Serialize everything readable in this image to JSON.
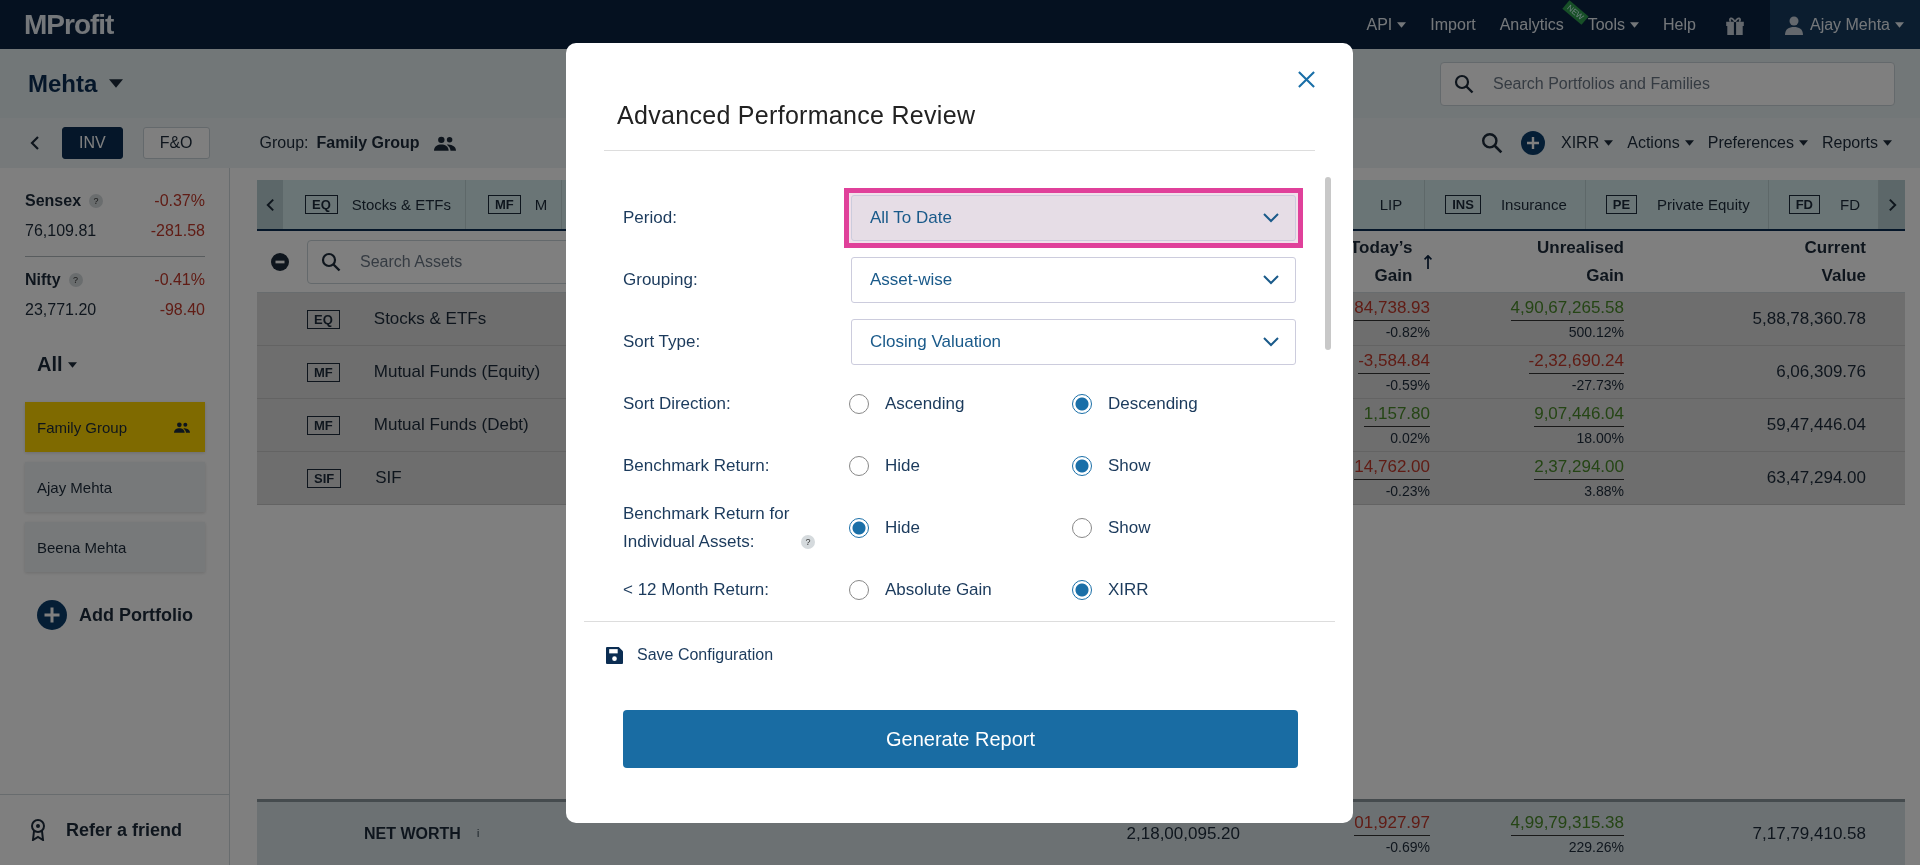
{
  "top_nav": {
    "logo": "MProfit",
    "items": [
      {
        "label": "API",
        "dropdown": true
      },
      {
        "label": "Import",
        "dropdown": false
      },
      {
        "label": "Analytics",
        "dropdown": false,
        "badge": "NEW"
      },
      {
        "label": "Tools",
        "dropdown": true
      },
      {
        "label": "Help",
        "dropdown": false
      }
    ],
    "user": "Ajay Mehta"
  },
  "header": {
    "family": "Mehta",
    "search_placeholder": "Search Portfolios and Families"
  },
  "toolbar": {
    "modes": [
      {
        "label": "INV",
        "selected": true
      },
      {
        "label": "F&O",
        "selected": false
      }
    ],
    "group_label": "Group:",
    "group_name": "Family Group",
    "menus": [
      "XIRR",
      "Actions",
      "Preferences",
      "Reports"
    ]
  },
  "indices": [
    {
      "name": "Sensex",
      "help": "?",
      "change_pct": "-0.37%",
      "value": "76,109.81",
      "change": "-281.58"
    },
    {
      "name": "Nifty",
      "help": "?",
      "change_pct": "-0.41%",
      "value": "23,771.20",
      "change": "-98.40"
    }
  ],
  "filter": "All",
  "portfolios": [
    {
      "label": "Family Group",
      "kind": "group",
      "selected": true
    },
    {
      "label": "Ajay Mehta",
      "kind": "portfolio",
      "selected": false
    },
    {
      "label": "Beena Mehta",
      "kind": "portfolio",
      "selected": false
    }
  ],
  "add_portfolio": "Add Portfolio",
  "refer": "Refer a friend",
  "asset_tabs": [
    {
      "code": "EQ",
      "label": "Stocks & ETFs"
    },
    {
      "code": "MF",
      "label": "M"
    },
    {
      "label": "LIP"
    },
    {
      "code": "INS",
      "label": "Insurance"
    },
    {
      "code": "PE",
      "label": "Private Equity"
    },
    {
      "code": "FD",
      "label": "FD"
    }
  ],
  "asset_search_placeholder": "Search Assets",
  "table": {
    "columns": [
      {
        "label": "Today’s Gain",
        "sorted": true
      },
      {
        "label": "Unrealised Gain",
        "sorted": false
      },
      {
        "label": "Current Value",
        "sorted": false
      }
    ],
    "rows": [
      {
        "code": "EQ",
        "name": "Stocks & ETFs",
        "todays_gain": "84,738.93",
        "todays_loss": true,
        "todays_pct": "-0.82%",
        "unrealised": "4,90,67,265.58",
        "unrealised_loss": false,
        "unrealised_pct": "500.12%",
        "current_value": "5,88,78,360.78"
      },
      {
        "code": "MF",
        "name": "Mutual Funds (Equity)",
        "todays_gain": "-3,584.84",
        "todays_loss": true,
        "todays_pct": "-0.59%",
        "unrealised": "-2,32,690.24",
        "unrealised_loss": true,
        "unrealised_pct": "-27.73%",
        "current_value": "6,06,309.76"
      },
      {
        "code": "MF",
        "name": "Mutual Funds (Debt)",
        "todays_gain": "1,157.80",
        "todays_loss": false,
        "todays_pct": "0.02%",
        "unrealised": "9,07,446.04",
        "unrealised_loss": false,
        "unrealised_pct": "18.00%",
        "current_value": "59,47,446.04"
      },
      {
        "code": "SIF",
        "name": "SIF",
        "todays_gain": "14,762.00",
        "todays_loss": true,
        "todays_pct": "-0.23%",
        "unrealised": "2,37,294.00",
        "unrealised_loss": false,
        "unrealised_pct": "3.88%",
        "current_value": "63,47,294.00"
      }
    ]
  },
  "net_worth": {
    "label": "NET WORTH",
    "info": "i",
    "invested": "2,18,00,095.20",
    "todays_gain": "01,927.97",
    "todays_loss": true,
    "todays_pct": "-0.69%",
    "unrealised": "4,99,79,315.38",
    "unrealised_loss": false,
    "unrealised_pct": "229.26%",
    "current_value": "7,17,79,410.58"
  },
  "modal": {
    "title": "Advanced Performance Review",
    "fields": [
      {
        "kind": "select",
        "label": "Period:",
        "value": "All To Date",
        "highlighted": true
      },
      {
        "kind": "select",
        "label": "Grouping:",
        "value": "Asset-wise",
        "highlighted": false
      },
      {
        "kind": "select",
        "label": "Sort Type:",
        "value": "Closing Valuation",
        "highlighted": false
      },
      {
        "kind": "radio",
        "label": "Sort Direction:",
        "options": [
          {
            "label": "Ascending",
            "selected": false
          },
          {
            "label": "Descending",
            "selected": true
          }
        ]
      },
      {
        "kind": "radio",
        "label": "Benchmark Return:",
        "options": [
          {
            "label": "Hide",
            "selected": false
          },
          {
            "label": "Show",
            "selected": true
          }
        ]
      },
      {
        "kind": "radio",
        "label": "Benchmark Return for Individual Assets:",
        "help": "?",
        "options": [
          {
            "label": "Hide",
            "selected": true
          },
          {
            "label": "Show",
            "selected": false
          }
        ]
      },
      {
        "kind": "radio",
        "label": "< 12 Month Return:",
        "options": [
          {
            "label": "Absolute Gain",
            "selected": false
          },
          {
            "label": "XIRR",
            "selected": true
          }
        ]
      }
    ],
    "save_label": "Save Configuration",
    "button": "Generate Report"
  }
}
